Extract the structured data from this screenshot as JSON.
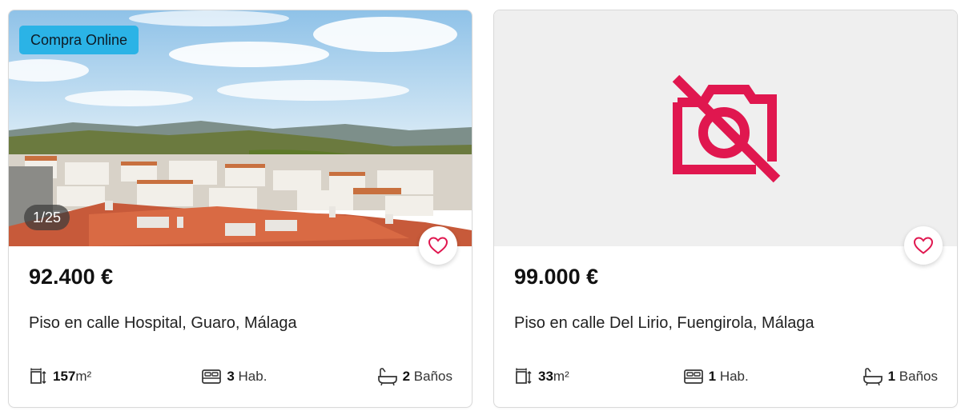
{
  "listings": [
    {
      "badge": "Compra Online",
      "photo_counter": "1/25",
      "price": "92.400 €",
      "title": "Piso en calle Hospital, Guaro, Málaga",
      "area_value": "157",
      "area_unit": "m²",
      "rooms_value": "3",
      "rooms_unit": "Hab.",
      "baths_value": "2",
      "baths_unit": "Baños",
      "has_photo": true
    },
    {
      "price": "99.000 €",
      "title": "Piso en calle Del Lirio, Fuengirola, Málaga",
      "area_value": "33",
      "area_unit": "m²",
      "rooms_value": "1",
      "rooms_unit": "Hab.",
      "baths_value": "1",
      "baths_unit": "Baños",
      "has_photo": false,
      "placeholder_icon": "no-photo-camera-icon"
    }
  ],
  "colors": {
    "accent": "#e0174f",
    "badge_bg": "#2bb3e6",
    "placeholder_bg": "#efefef"
  }
}
